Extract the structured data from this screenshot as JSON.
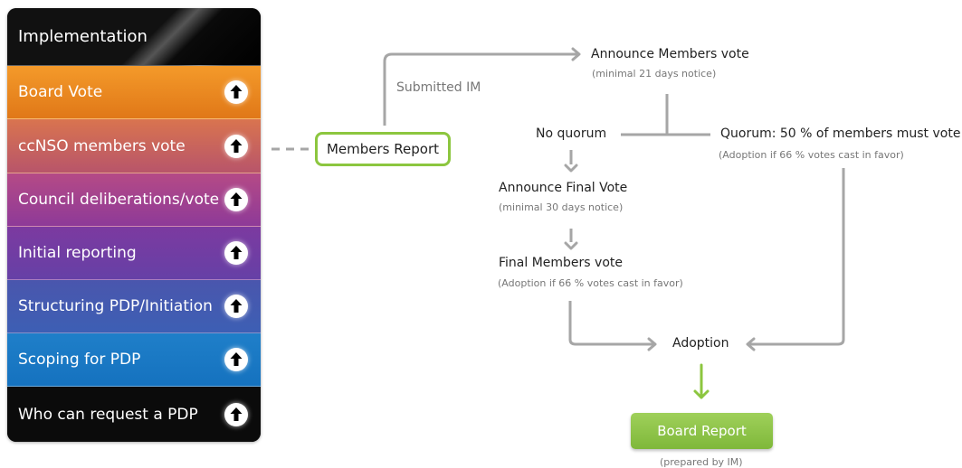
{
  "stages": [
    {
      "label": "Implementation",
      "has_icon": false
    },
    {
      "label": "Board Vote",
      "has_icon": true
    },
    {
      "label": "ccNSO members vote",
      "has_icon": true
    },
    {
      "label": "Council deliberations/vote",
      "has_icon": true
    },
    {
      "label": "Initial reporting",
      "has_icon": true
    },
    {
      "label": "Structuring PDP/Initiation",
      "has_icon": true
    },
    {
      "label": "Scoping for PDP",
      "has_icon": true
    },
    {
      "label": "Who can request a PDP",
      "has_icon": true
    }
  ],
  "icons": {
    "stage_arrow": "arrow-up-circle-icon"
  },
  "colors": {
    "accent_green": "#8cc63f",
    "connector_gray": "#a6a6a6"
  },
  "flow": {
    "members_report": "Members Report",
    "submitted_im": "Submitted IM",
    "announce_members_vote": {
      "title": "Announce Members vote",
      "note": "(minimal 21 days notice)"
    },
    "no_quorum": "No quorum",
    "quorum": {
      "title": "Quorum: 50 % of members must  vote",
      "note": "(Adoption if 66 % votes cast in favor)"
    },
    "announce_final_vote": {
      "title": "Announce Final  Vote",
      "note": "(minimal 30 days notice)"
    },
    "final_members_vote": {
      "title": "Final Members vote",
      "note": "(Adoption if 66 % votes cast in favor)"
    },
    "adoption": "Adoption",
    "board_report": {
      "title": "Board Report",
      "note": "(prepared by IM)"
    }
  }
}
